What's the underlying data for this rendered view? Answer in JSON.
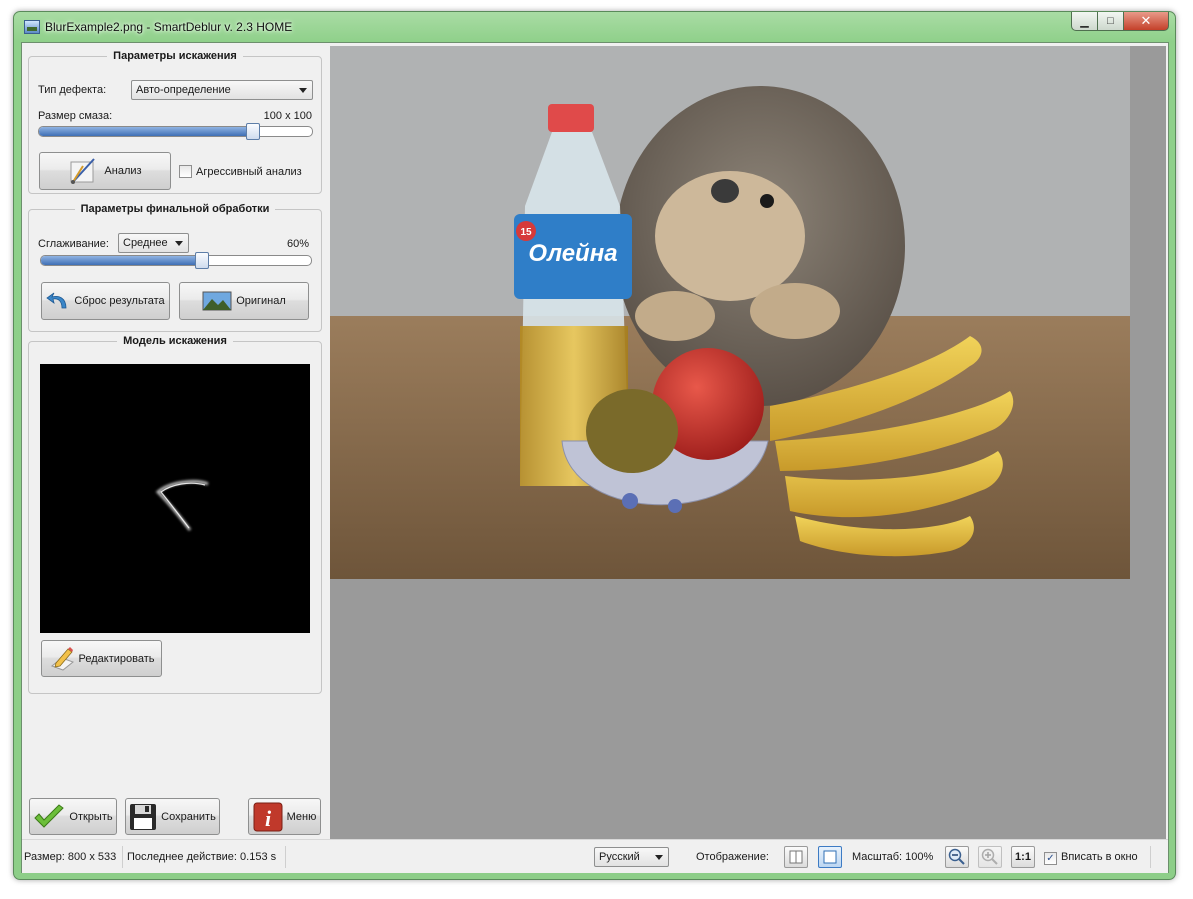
{
  "window": {
    "title": "BlurExample2.png - SmartDeblur v. 2.3 HOME",
    "minimize_glyph": "▁",
    "maximize_glyph": "□",
    "close_glyph": "✕"
  },
  "distortion_params": {
    "legend": "Параметры искажения",
    "defect_type_label": "Тип дефекта:",
    "defect_type_value": "Авто-определение",
    "blur_size_label": "Размер смаза:",
    "blur_size_value": "100 x 100",
    "blur_slider_level": 0.8,
    "analyze_button": "Анализ",
    "aggressive_checkbox_label": "Агрессивный анализ",
    "aggressive_checked": false
  },
  "final_processing": {
    "legend": "Параметры финальной обработки",
    "smoothing_label": "Сглаживание:",
    "smoothing_value": "Среднее",
    "smoothing_percent": "60%",
    "smoothing_slider_level": 0.6,
    "reset_button": "Сброс результата",
    "original_button": "Оригинал"
  },
  "distortion_model": {
    "legend": "Модель искажения",
    "edit_button": "Редактировать"
  },
  "bottom_buttons": {
    "open": "Открыть",
    "save": "Сохранить",
    "menu": "Меню"
  },
  "photo_label": {
    "brand": "Олейна",
    "badge": "15"
  },
  "statusbar": {
    "size": "Размер: 800 x 533",
    "last_action": "Последнее действие: 0.153 s",
    "language": "Русский",
    "display_label": "Отображение:",
    "zoom_label": "Масштаб: 100%",
    "one_to_one": "1:1",
    "fit_label": "Вписать в окно",
    "fit_checked": true,
    "check_glyph": "✓"
  },
  "colors": {
    "frame_green": "#8fd08a",
    "slider_blue": "#3f6fb5",
    "menu_red": "#c0392b",
    "open_green": "#6cbf3a"
  }
}
